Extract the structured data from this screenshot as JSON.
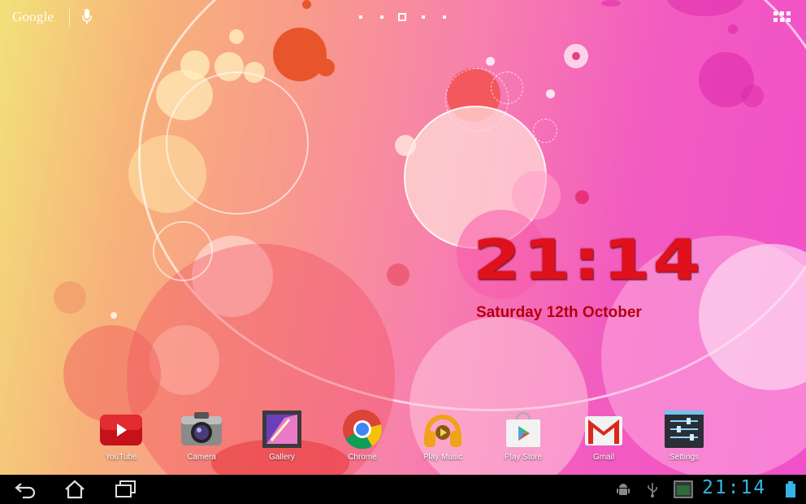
{
  "search": {
    "logo_text": "Google",
    "mic_icon": "mic-icon"
  },
  "pages": {
    "count": 5,
    "active_index": 2
  },
  "clock": {
    "time": "21:14",
    "date": "Saturday 12th October",
    "color": "#e0101c"
  },
  "dock": {
    "apps": [
      {
        "label": "YouTube",
        "icon": "youtube-icon"
      },
      {
        "label": "Camera",
        "icon": "camera-icon"
      },
      {
        "label": "Gallery",
        "icon": "gallery-icon"
      },
      {
        "label": "Chrome",
        "icon": "chrome-icon"
      },
      {
        "label": "Play Music",
        "icon": "play-music-icon"
      },
      {
        "label": "Play Store",
        "icon": "play-store-icon"
      },
      {
        "label": "Gmail",
        "icon": "gmail-icon"
      },
      {
        "label": "Settings",
        "icon": "settings-icon"
      }
    ]
  },
  "status": {
    "time": "21:14",
    "accent": "#34b5e5"
  },
  "nav": {
    "back": "back-icon",
    "home": "home-icon",
    "recents": "recents-icon"
  }
}
